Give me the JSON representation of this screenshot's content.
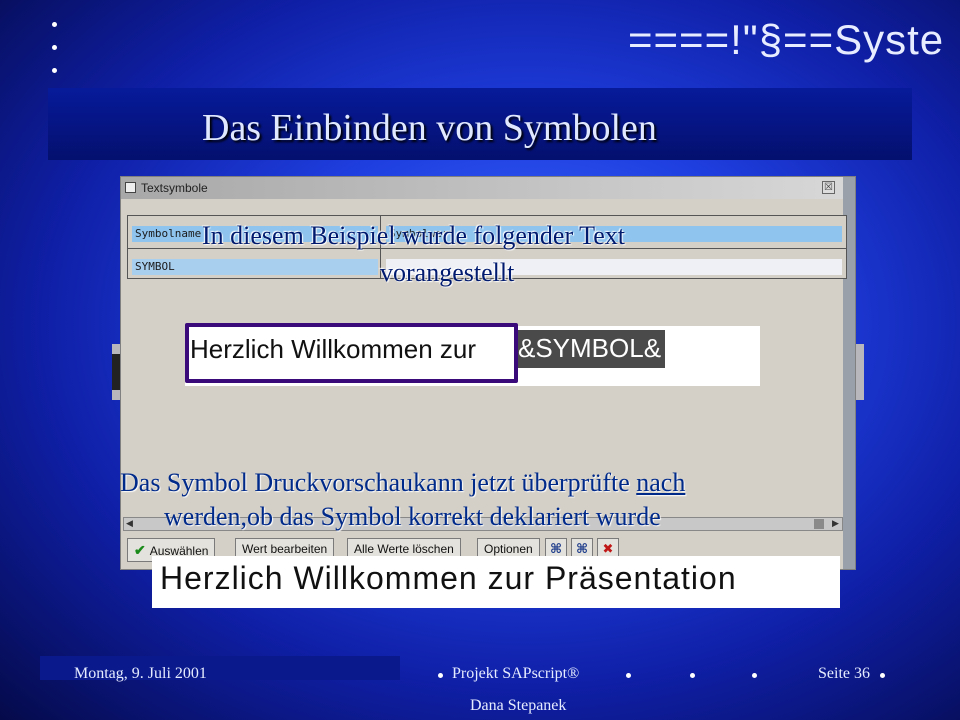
{
  "brand": {
    "text": "====!\"§==Syste"
  },
  "title": "Das Einbinden von Symbolen",
  "dialog": {
    "title": "Textsymbole",
    "close": "☒",
    "table": {
      "header": [
        "Symbolname",
        "Symbolwert"
      ],
      "row": [
        "SYMBOL",
        ""
      ]
    },
    "buttons": {
      "select": "Auswählen",
      "edit": "Wert bearbeiten",
      "clear": "Alle Werte löschen",
      "options": "Optionen"
    },
    "icons": [
      "binoculars-icon",
      "binoculars-next-icon",
      "cancel-icon"
    ]
  },
  "overlay": {
    "line1": "In diesem Beispiel wurde folgender Text",
    "line2": "vorangestellt"
  },
  "input": {
    "text": "Herzlich Willkommen zur",
    "symbol": "&SYMBOL&"
  },
  "lower": {
    "line1_a": "Das Symbol Druckvorschaukann jetzt überprüfte",
    "line1_u": "nach",
    "line2": "werden,ob das Symbol korrekt deklariert wurde"
  },
  "result": "Herzlich Willkommen zur Präsentation",
  "footer": {
    "date": "Montag, 9. Juli 2001",
    "project": "Projekt SAPscript®",
    "page": "Seite 36",
    "author": "Dana Stepanek"
  },
  "colors": {
    "title_bar": "#071a9a",
    "frame": "#3a0a7a",
    "highlight": "#8fc4ee"
  }
}
